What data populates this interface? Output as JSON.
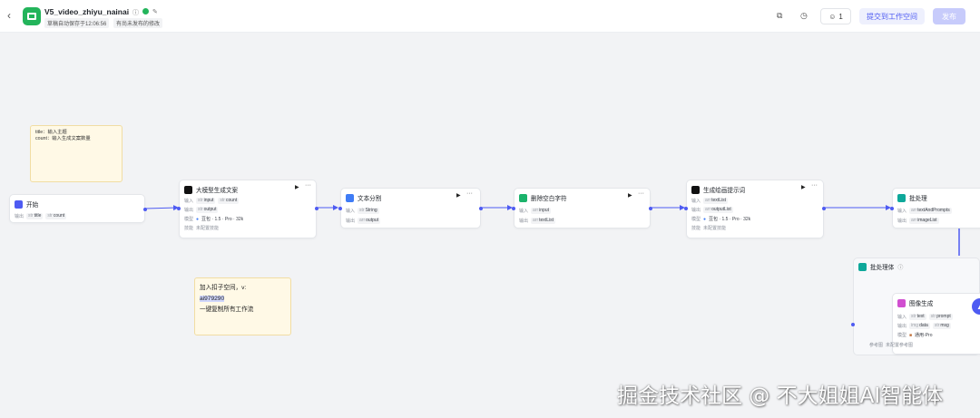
{
  "header": {
    "back_icon": "chevron-left-icon",
    "title": "V5_video_zhiyu_nainai",
    "autosave": "草稿自动保存于12:06:56",
    "unpublished": "有尚未发布的修改",
    "collaborators": "1",
    "submit_label": "提交到工作空间",
    "publish_label": "发布",
    "accent": "#4e5bf2",
    "brand": "#23b45b"
  },
  "nodes": {
    "start": {
      "title": "开始",
      "in_label": "输出",
      "p1": "title",
      "p2": "count",
      "color": "#4e5bf2"
    },
    "llm1": {
      "title": "大模型生成文案",
      "in_label": "输入",
      "out_label": "输出",
      "model_label": "模型",
      "skill_label": "技能",
      "i1": "input",
      "i2": "count",
      "o1": "output",
      "model": "豆包 · 1.5 · Pro · 32k",
      "skill": "未配置技能",
      "color": "#111111"
    },
    "split": {
      "title": "文本分割",
      "in_label": "输入",
      "out_label": "输出",
      "i1": "String",
      "o1": "output",
      "color": "#3f7cf6"
    },
    "trim": {
      "title": "删除空白字符",
      "in_label": "输入",
      "out_label": "输出",
      "i1": "input",
      "o1": "textList",
      "color": "#1bb36b"
    },
    "llm2": {
      "title": "生成绘画提示词",
      "in_label": "输入",
      "out_label": "输出",
      "model_label": "模型",
      "skill_label": "技能",
      "i1": "textList",
      "o1": "outputList",
      "model": "豆包 · 1.5 · Pro · 32k",
      "skill": "未配置技能",
      "color": "#111111"
    },
    "batch": {
      "title": "批处理",
      "in_label": "输入",
      "out_label": "输出",
      "i1": "textAndPrompts",
      "o1": "imageList",
      "color": "#0ea89a"
    },
    "batchbody": {
      "title": "批处理体"
    },
    "image": {
      "title": "图像生成",
      "in_label": "输入",
      "out_label": "输出",
      "model_label": "模型",
      "ref_label": "参考图",
      "i1": "text",
      "i2": "prompt",
      "o1": "data",
      "o2": "msg",
      "model": "通用-Pro",
      "ref": "未配置参考图",
      "color": "#d04fd0"
    }
  },
  "notes": {
    "note1": {
      "line1": "title：输入主题",
      "line2": "count：输入生成文案数量"
    },
    "note2": {
      "line1": "加入扣子空间，v:",
      "line2": "ai979290",
      "line3": "一键复制所有工作流"
    }
  },
  "watermark": "掘金技术社区 @ 不大姐姐AI智能体"
}
